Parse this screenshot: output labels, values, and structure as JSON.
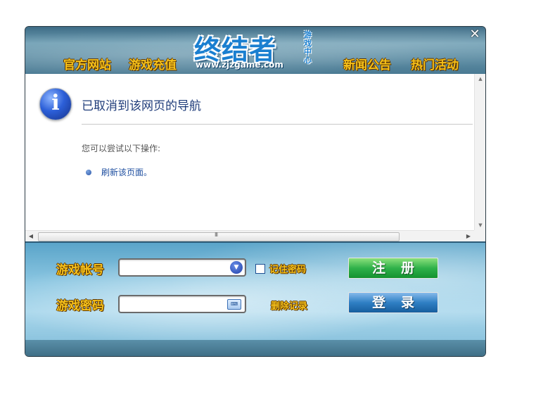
{
  "header": {
    "nav_left": [
      "官方网站",
      "游戏充值"
    ],
    "nav_right": [
      "新闻公告",
      "热门活动"
    ],
    "logo_title": "终结者",
    "logo_url": "www.zjzgame.com",
    "logo_side": "游戏中心",
    "close_icon": "close-icon"
  },
  "content": {
    "title": "已取消到该网页的导航",
    "hint": "您可以尝试以下操作:",
    "refresh_link": "刷新该页面。",
    "scroll_grip": "III"
  },
  "login": {
    "account_label": "游戏帐号",
    "account_value": "",
    "password_label": "游戏密码",
    "password_value": "",
    "remember_label": "记住密码",
    "delete_label": "删除记录",
    "register_button": "注册",
    "login_button": "登录"
  },
  "colors": {
    "gold_text": "#f6c11a",
    "register_green": "#2fb14a",
    "login_blue": "#2f7fc4",
    "link_blue": "#1f4fa0"
  }
}
